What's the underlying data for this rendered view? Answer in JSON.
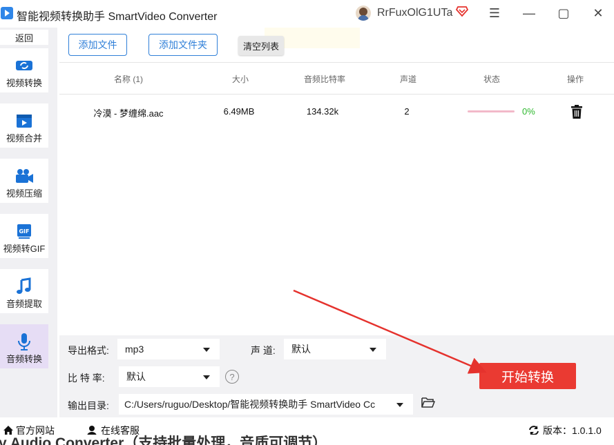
{
  "app": {
    "title": "智能视频转换助手 SmartVideo Converter",
    "username": "RrFuxOlG1UTa"
  },
  "window": {
    "menu_glyph": "☰",
    "minimize_glyph": "—",
    "maximize_glyph": "▢",
    "close_glyph": "✕"
  },
  "sidebar": {
    "back_label": "返回",
    "items": [
      {
        "label": "视频转换",
        "icon": "video-convert-icon"
      },
      {
        "label": "视频合并",
        "icon": "video-merge-icon"
      },
      {
        "label": "视频压缩",
        "icon": "video-compress-icon"
      },
      {
        "label": "视频转GIF",
        "icon": "gif-icon"
      },
      {
        "label": "音频提取",
        "icon": "music-note-icon"
      },
      {
        "label": "音频转换",
        "icon": "microphone-icon",
        "active": true
      }
    ]
  },
  "toolbar": {
    "add_file": "添加文件",
    "add_folder": "添加文件夹",
    "clear_list": "清空列表"
  },
  "table": {
    "headers": [
      "名称 (1)",
      "大小",
      "音频比特率",
      "声道",
      "状态",
      "操作"
    ],
    "rows": [
      {
        "name": "冷漠 - 梦缠绵.aac",
        "size": "6.49MB",
        "bitrate": "134.32k",
        "channels": "2",
        "progress": 0,
        "status": "0%"
      }
    ]
  },
  "settings": {
    "format_label": "导出格式:",
    "format_value": "mp3",
    "channel_label": "声 道:",
    "channel_value": "默认",
    "bitrate_label": "比 特 率:",
    "bitrate_value": "默认",
    "help_glyph": "?",
    "output_label": "输出目录:",
    "output_value": "C:/Users/ruguo/Desktop/智能视频转换助手 SmartVideo Cc",
    "start_button": "开始转换"
  },
  "statusbar": {
    "website": "官方网站",
    "support": "在线客服",
    "version": "版本：1.0.1.0"
  },
  "underlay_text": "y Audio Converter（支持批量处理，音质可调节）",
  "colors": {
    "accent": "#2f7fd8",
    "start_button": "#ea3a32",
    "progress_ok": "#2eb82e",
    "arrow": "#e5322d",
    "active_sidebar": "#e6ddf5"
  }
}
